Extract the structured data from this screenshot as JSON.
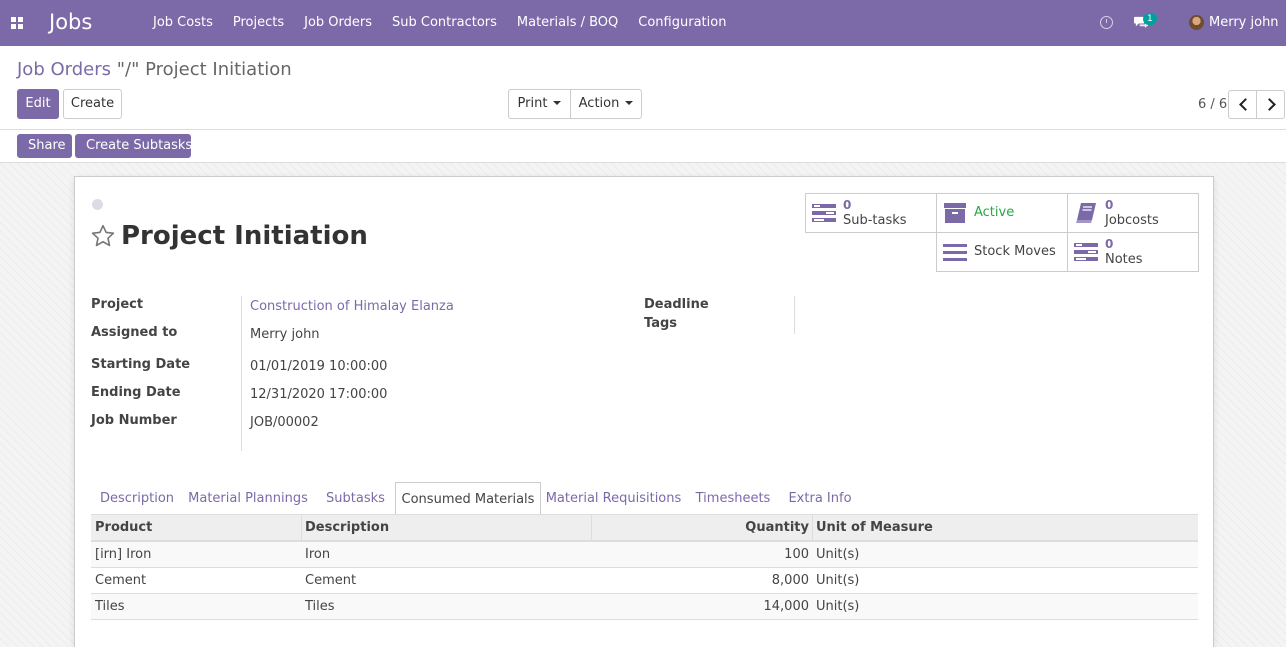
{
  "navbar": {
    "app_title": "Jobs",
    "menu": [
      "Job Costs",
      "Projects",
      "Job Orders",
      "Sub Contractors",
      "Materials / BOQ",
      "Configuration"
    ],
    "chat_badge": "1",
    "user_name": "Merry john"
  },
  "control_panel": {
    "breadcrumb_parent": "Job Orders",
    "breadcrumb_sep": " \"/\" ",
    "breadcrumb_current": "Project Initiation",
    "edit_label": "Edit",
    "create_label": "Create",
    "print_label": "Print",
    "action_label": "Action",
    "pager": "6 / 6"
  },
  "statusbar": {
    "share_label": "Share",
    "create_subtasks_label": "Create Subtasks"
  },
  "record": {
    "title": "Project Initiation",
    "smart_buttons": {
      "subtasks": {
        "value": "0",
        "label": "Sub-tasks"
      },
      "active": {
        "label": "Active"
      },
      "jobcosts": {
        "value": "0",
        "label": "Jobcosts"
      },
      "stock_moves": {
        "label": "Stock Moves"
      },
      "notes": {
        "value": "0",
        "label": "Notes"
      }
    },
    "fields": {
      "project": {
        "label": "Project",
        "value": "Construction of Himalay Elanza"
      },
      "assigned_to": {
        "label": "Assigned to",
        "value": "Merry john"
      },
      "starting_date": {
        "label": "Starting Date",
        "value": "01/01/2019 10:00:00"
      },
      "ending_date": {
        "label": "Ending Date",
        "value": "12/31/2020 17:00:00"
      },
      "job_number": {
        "label": "Job Number",
        "value": "JOB/00002"
      },
      "deadline": {
        "label": "Deadline",
        "value": ""
      },
      "tags": {
        "label": "Tags",
        "value": ""
      }
    }
  },
  "tabs": [
    "Description",
    "Material Plannings",
    "Subtasks",
    "Consumed Materials",
    "Material Requisitions",
    "Timesheets",
    "Extra Info"
  ],
  "active_tab": "Consumed Materials",
  "table": {
    "headers": {
      "product": "Product",
      "description": "Description",
      "quantity": "Quantity",
      "uom": "Unit of Measure"
    },
    "rows": [
      {
        "product": "[irn] Iron",
        "description": "Iron",
        "quantity": "100",
        "uom": "Unit(s)"
      },
      {
        "product": "Cement",
        "description": "Cement",
        "quantity": "8,000",
        "uom": "Unit(s)"
      },
      {
        "product": "Tiles",
        "description": "Tiles",
        "quantity": "14,000",
        "uom": "Unit(s)"
      }
    ]
  },
  "colors": {
    "brand": "#7c6aa8",
    "active_green": "#28a745",
    "badge_teal": "#00a09d"
  }
}
